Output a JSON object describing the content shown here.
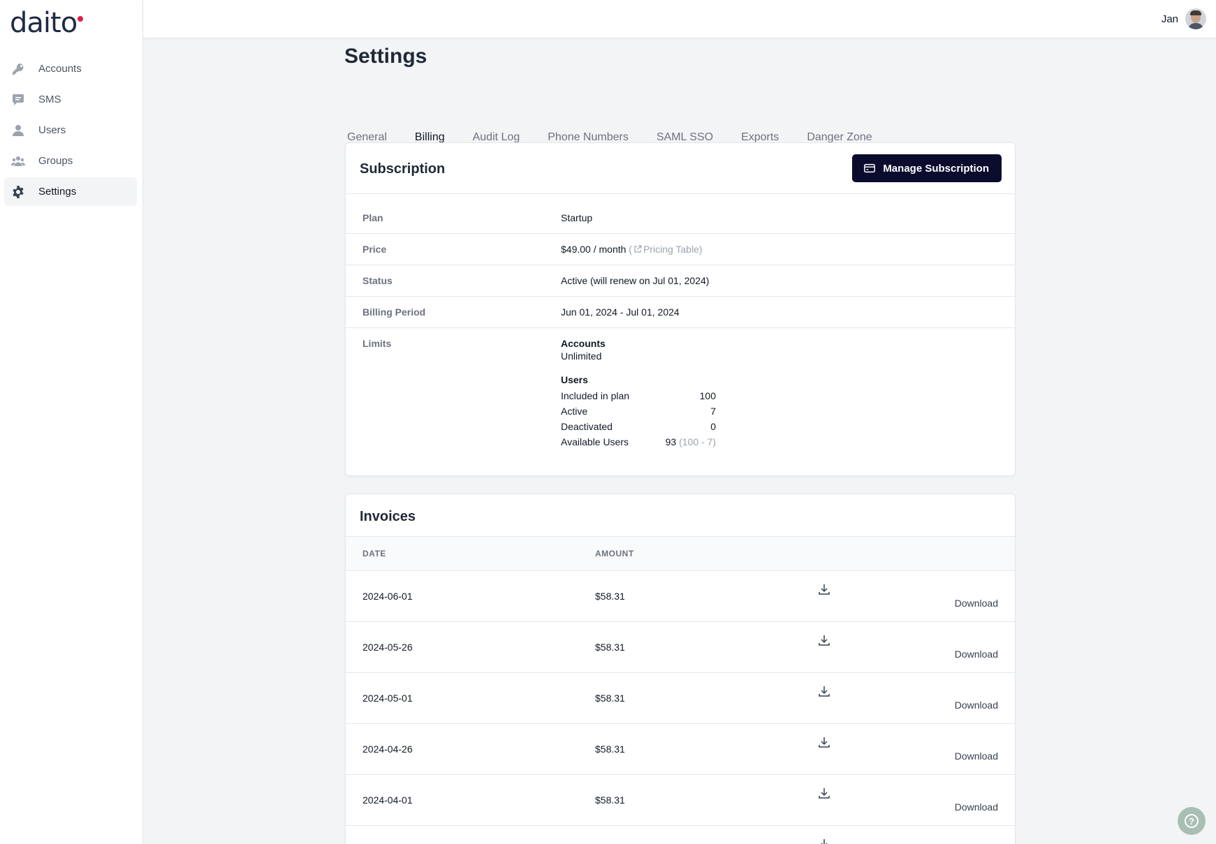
{
  "brand": {
    "logo_text": "daito",
    "accent": "#e11d48",
    "dark": "#0b0b2e"
  },
  "sidebar": {
    "items": [
      {
        "label": "Accounts",
        "icon": "key-icon"
      },
      {
        "label": "SMS",
        "icon": "chat-icon"
      },
      {
        "label": "Users",
        "icon": "user-icon"
      },
      {
        "label": "Groups",
        "icon": "users-group-icon"
      },
      {
        "label": "Settings",
        "icon": "gear-icon",
        "active": true
      }
    ]
  },
  "header": {
    "user_name": "Jan"
  },
  "page": {
    "title": "Settings",
    "tabs": [
      {
        "label": "General"
      },
      {
        "label": "Billing",
        "active": true
      },
      {
        "label": "Audit Log"
      },
      {
        "label": "Phone Numbers"
      },
      {
        "label": "SAML SSO"
      },
      {
        "label": "Exports"
      },
      {
        "label": "Danger Zone"
      }
    ]
  },
  "subscription": {
    "title": "Subscription",
    "manage_label": "Manage Subscription",
    "plan_label": "Plan",
    "plan_value": "Startup",
    "price_label": "Price",
    "price_value": "$49.00 / month",
    "price_open": "(",
    "pricing_link": "Pricing Table)",
    "status_label": "Status",
    "status_value": "Active (will renew on Jul 01, 2024)",
    "billing_label": "Billing Period",
    "billing_value": "Jun 01, 2024 - Jul 01, 2024",
    "limits_label": "Limits",
    "limits": {
      "accounts_head": "Accounts",
      "accounts_value": "Unlimited",
      "users_head": "Users",
      "rows": [
        {
          "label": "Included in plan",
          "value": "100",
          "note": ""
        },
        {
          "label": "Active",
          "value": "7",
          "note": ""
        },
        {
          "label": "Deactivated",
          "value": "0",
          "note": ""
        },
        {
          "label": "Available Users",
          "value": "93",
          "note": "(100 - 7)"
        }
      ]
    }
  },
  "invoices": {
    "title": "Invoices",
    "col_date": "DATE",
    "col_amount": "AMOUNT",
    "download_label": "Download",
    "rows": [
      {
        "date": "2024-06-01",
        "amount": "$58.31"
      },
      {
        "date": "2024-05-26",
        "amount": "$58.31"
      },
      {
        "date": "2024-05-01",
        "amount": "$58.31"
      },
      {
        "date": "2024-04-26",
        "amount": "$58.31"
      },
      {
        "date": "2024-04-01",
        "amount": "$58.31"
      },
      {
        "date": "",
        "amount": ""
      }
    ]
  },
  "help": {
    "label": "?"
  }
}
